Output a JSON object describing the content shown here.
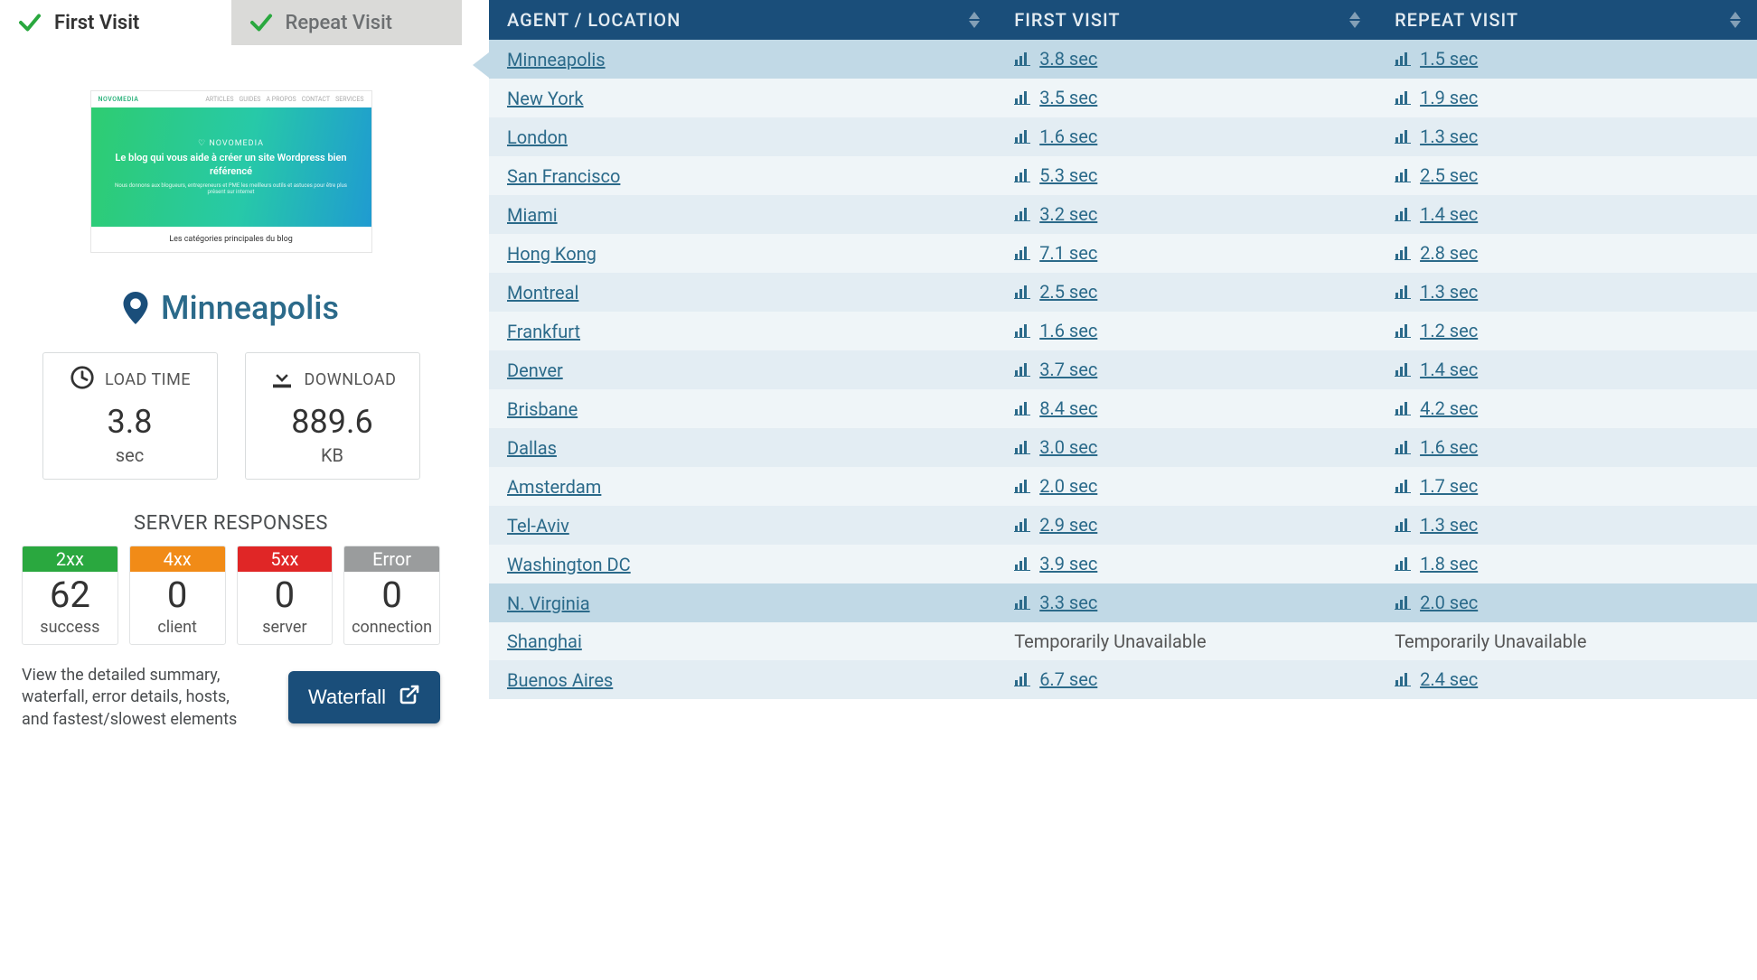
{
  "tabs": {
    "first": "First Visit",
    "repeat": "Repeat Visit"
  },
  "thumbnail": {
    "brand": "NOVOMEDIA",
    "nav_links": [
      "ARTICLES",
      "GUIDES",
      "A PROPOS",
      "CONTACT",
      "SERVICES"
    ],
    "hero_brand": "♡ NOVOMEDIA",
    "hero_headline": "Le blog qui vous aide à créer un site Wordpress bien référencé",
    "hero_sub": "Nous donnons aux blogueurs, entrepreneurs et PME les meilleurs outils et astuces pour être plus présent sur internet",
    "footer": "Les catégories principales du blog"
  },
  "location": {
    "name": "Minneapolis"
  },
  "metrics": {
    "load_time": {
      "label": "LOAD TIME",
      "value": "3.8",
      "unit": "sec"
    },
    "download": {
      "label": "DOWNLOAD",
      "value": "889.6",
      "unit": "KB"
    }
  },
  "responses": {
    "heading": "SERVER RESPONSES",
    "items": [
      {
        "code": "2xx",
        "count": "62",
        "label": "success",
        "class": "hdr-2xx"
      },
      {
        "code": "4xx",
        "count": "0",
        "label": "client",
        "class": "hdr-4xx"
      },
      {
        "code": "5xx",
        "count": "0",
        "label": "server",
        "class": "hdr-5xx"
      },
      {
        "code": "Error",
        "count": "0",
        "label": "connection",
        "class": "hdr-err"
      }
    ]
  },
  "footer": {
    "help_text": "View the detailed summary, waterfall, error details, hosts, and fastest/slowest elements",
    "button_label": "Waterfall"
  },
  "table": {
    "columns": [
      "AGENT / LOCATION",
      "FIRST VISIT",
      "REPEAT VISIT"
    ],
    "rows": [
      {
        "location": "Minneapolis",
        "first": "3.8 sec",
        "repeat": "1.5 sec",
        "selected": true
      },
      {
        "location": "New York",
        "first": "3.5 sec",
        "repeat": "1.9 sec"
      },
      {
        "location": "London",
        "first": "1.6 sec",
        "repeat": "1.3 sec"
      },
      {
        "location": "San Francisco",
        "first": "5.3 sec",
        "repeat": "2.5 sec"
      },
      {
        "location": "Miami",
        "first": "3.2 sec",
        "repeat": "1.4 sec"
      },
      {
        "location": "Hong Kong",
        "first": "7.1 sec",
        "repeat": "2.8 sec"
      },
      {
        "location": "Montreal",
        "first": "2.5 sec",
        "repeat": "1.3 sec"
      },
      {
        "location": "Frankfurt",
        "first": "1.6 sec",
        "repeat": "1.2 sec"
      },
      {
        "location": "Denver",
        "first": "3.7 sec",
        "repeat": "1.4 sec"
      },
      {
        "location": "Brisbane",
        "first": "8.4 sec",
        "repeat": "4.2 sec"
      },
      {
        "location": "Dallas",
        "first": "3.0 sec",
        "repeat": "1.6 sec"
      },
      {
        "location": "Amsterdam",
        "first": "2.0 sec",
        "repeat": "1.7 sec"
      },
      {
        "location": "Tel-Aviv",
        "first": "2.9 sec",
        "repeat": "1.3 sec"
      },
      {
        "location": "Washington DC",
        "first": "3.9 sec",
        "repeat": "1.8 sec"
      },
      {
        "location": "N. Virginia",
        "first": "3.3 sec",
        "repeat": "2.0 sec",
        "highlight": true
      },
      {
        "location": "Shanghai",
        "first_text": "Temporarily Unavailable",
        "repeat_text": "Temporarily Unavailable",
        "unavailable": true
      },
      {
        "location": "Buenos Aires",
        "first": "6.7 sec",
        "repeat": "2.4 sec"
      }
    ]
  }
}
